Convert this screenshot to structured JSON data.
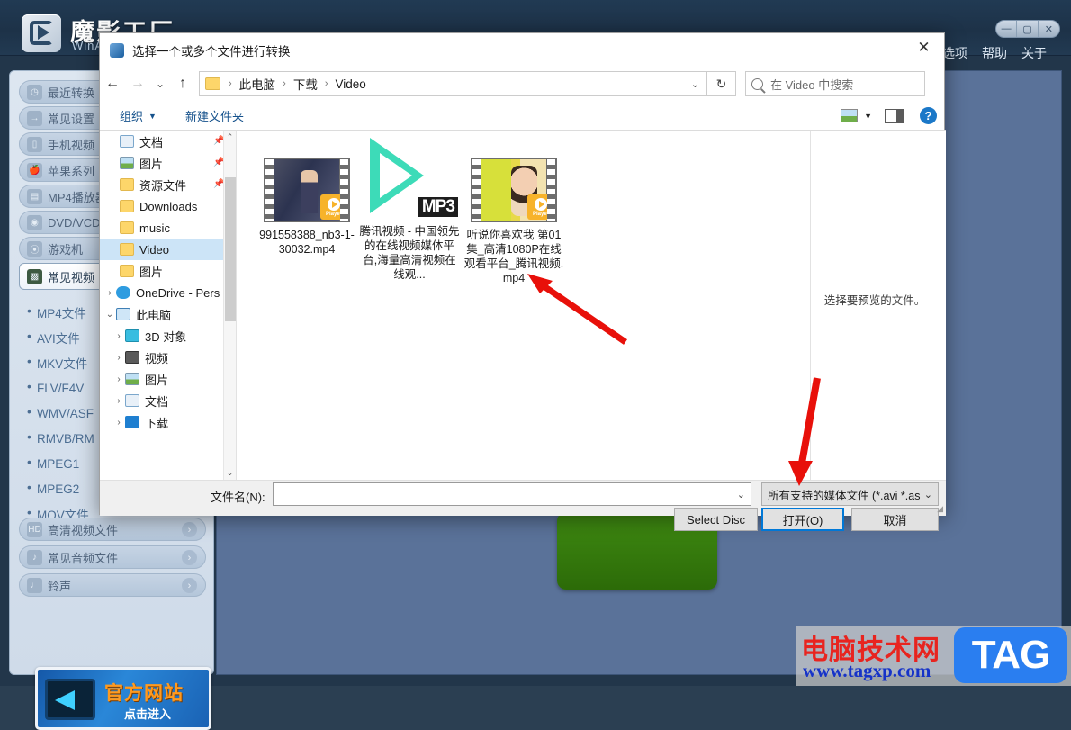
{
  "app": {
    "title_cn": "魔影工厂",
    "title_en": "WinAVI",
    "menu": [
      {
        "label": "选项"
      },
      {
        "label": "帮助"
      },
      {
        "label": "关于"
      }
    ],
    "window_controls": [
      {
        "name": "minimize",
        "glyph": "—"
      },
      {
        "name": "maximize",
        "glyph": "▢"
      },
      {
        "name": "close",
        "glyph": "✕"
      }
    ],
    "sidebar": {
      "categories": [
        {
          "label": "最近转换",
          "icon": "clock-icon"
        },
        {
          "label": "常见设置",
          "icon": "arrow-right-icon"
        },
        {
          "label": "手机视频",
          "icon": "phone-icon"
        },
        {
          "label": "苹果系列",
          "icon": "apple-icon"
        },
        {
          "label": "MP4播放器",
          "icon": "mp4-player-icon"
        },
        {
          "label": "DVD/VCD",
          "icon": "disc-icon"
        },
        {
          "label": "游戏机",
          "icon": "gamepad-icon"
        },
        {
          "label": "常见视频",
          "icon": "film-icon"
        }
      ],
      "formats": [
        {
          "label": "MP4文件"
        },
        {
          "label": "AVI文件"
        },
        {
          "label": "MKV文件"
        },
        {
          "label": "FLV/F4V"
        },
        {
          "label": "WMV/ASF"
        },
        {
          "label": "RMVB/RM"
        },
        {
          "label": "MPEG1"
        },
        {
          "label": "MPEG2"
        },
        {
          "label": "MOV文件"
        }
      ],
      "bottom_categories": [
        {
          "label": "高清视频文件",
          "icon": "hd-icon"
        },
        {
          "label": "常见音频文件",
          "icon": "music-note-icon"
        },
        {
          "label": "铃声",
          "icon": "bell-icon"
        }
      ],
      "banner": {
        "main": "官方网站",
        "sub": "点击进入"
      }
    }
  },
  "dialog": {
    "title": "选择一个或多个文件进行转换",
    "close_glyph": "✕",
    "nav": {
      "back_glyph": "←",
      "forward_glyph": "→",
      "history_glyph": "⌄",
      "up_glyph": "↑",
      "refresh_glyph": "↻",
      "breadcrumb": [
        "此电脑",
        "下载",
        "Video"
      ],
      "breadcrumb_sep": "›",
      "dropdown_glyph": "⌄"
    },
    "search": {
      "placeholder": "在 Video 中搜索"
    },
    "toolbar": {
      "organize_label": "组织",
      "organize_caret": "▼",
      "new_folder_label": "新建文件夹",
      "view_caret": "▼",
      "help_glyph": "?"
    },
    "tree": [
      {
        "label": "文档",
        "icon": "document-icon",
        "indent": 1,
        "expander": "",
        "pinned": true,
        "selected": false
      },
      {
        "label": "图片",
        "icon": "picture-icon",
        "indent": 1,
        "expander": "",
        "pinned": true,
        "selected": false
      },
      {
        "label": "资源文件",
        "icon": "folder-icon",
        "indent": 1,
        "expander": "",
        "pinned": true,
        "selected": false
      },
      {
        "label": "Downloads",
        "icon": "folder-icon",
        "indent": 1,
        "expander": "",
        "pinned": false,
        "selected": false
      },
      {
        "label": "music",
        "icon": "folder-icon",
        "indent": 1,
        "expander": "",
        "pinned": false,
        "selected": false
      },
      {
        "label": "Video",
        "icon": "folder-icon",
        "indent": 1,
        "expander": "",
        "pinned": false,
        "selected": true
      },
      {
        "label": "图片",
        "icon": "folder-icon",
        "indent": 1,
        "expander": "",
        "pinned": false,
        "selected": false
      },
      {
        "label": "OneDrive - Pers",
        "icon": "cloud-icon",
        "indent": 0,
        "expander": "›",
        "pinned": false,
        "selected": false
      },
      {
        "label": "此电脑",
        "icon": "computer-icon",
        "indent": 0,
        "expander": "⌄",
        "pinned": false,
        "selected": false
      },
      {
        "label": "3D 对象",
        "icon": "3d-object-icon",
        "indent": 1,
        "expander": "›",
        "pinned": false,
        "selected": false
      },
      {
        "label": "视频",
        "icon": "video-icon",
        "indent": 1,
        "expander": "›",
        "pinned": false,
        "selected": false
      },
      {
        "label": "图片",
        "icon": "picture-icon",
        "indent": 1,
        "expander": "›",
        "pinned": false,
        "selected": false
      },
      {
        "label": "文档",
        "icon": "document-icon",
        "indent": 1,
        "expander": "›",
        "pinned": false,
        "selected": false
      },
      {
        "label": "下载",
        "icon": "download-icon",
        "indent": 1,
        "expander": "›",
        "pinned": false,
        "selected": false
      }
    ],
    "tree_scroll": {
      "up_glyph": "⌃",
      "down_glyph": "⌄"
    },
    "files": [
      {
        "name": "991558388_nb3-1-30032.mp4",
        "thumb": "video-thumbnail-dark",
        "badge": "Player"
      },
      {
        "name": "腾讯视频 - 中国领先的在线视频媒体平台,海量高清视频在线观...",
        "thumb": "mp3-shortcut",
        "badge": "MP3"
      },
      {
        "name": "听说你喜欢我 第01集_高清1080P在线观看平台_腾讯视频.mp4",
        "thumb": "video-thumbnail-yellow",
        "badge": "Player"
      }
    ],
    "preview": {
      "text": "选择要预览的文件。"
    },
    "bottom": {
      "filename_label": "文件名(N):",
      "filename_value": "",
      "filename_caret": "⌄",
      "filetype_value": "所有支持的媒体文件 (*.avi *.as",
      "filetype_caret": "⌄",
      "select_disc_label": "Select Disc",
      "open_label": "打开(O)",
      "cancel_label": "取消",
      "resize_grip": "◢"
    }
  },
  "watermark": {
    "cn": "电脑技术网",
    "url": "www.tagxp.com",
    "tag": "TAG"
  },
  "colors": {
    "accent_blue": "#0078d7",
    "app_bg": "#5a7299",
    "sidebar_bg": "#dde6f0",
    "selection": "#cce4f7",
    "banner_orange": "#ff9a1f",
    "watermark_red": "#e8241f"
  }
}
